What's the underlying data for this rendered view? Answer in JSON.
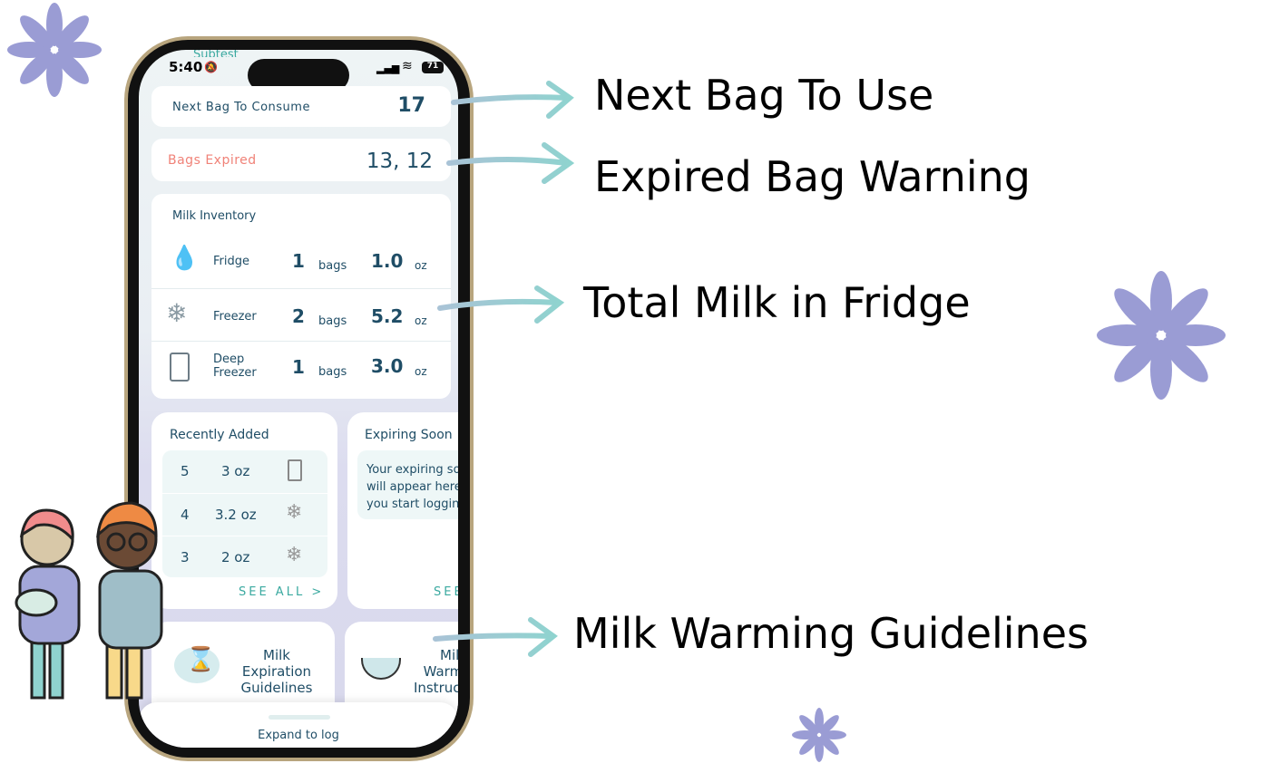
{
  "status": {
    "time": "5:40",
    "battery": "71"
  },
  "app_header_partial": "Subtest",
  "next_bag": {
    "label": "Next Bag To Consume",
    "value": "17"
  },
  "expired": {
    "label": "Bags Expired",
    "value": "13, 12"
  },
  "inventory": {
    "title": "Milk Inventory",
    "rows": [
      {
        "name": "Fridge",
        "count": "1",
        "count_unit": "bags",
        "amount": "1.0",
        "amount_unit": "oz"
      },
      {
        "name": "Freezer",
        "count": "2",
        "count_unit": "bags",
        "amount": "5.2",
        "amount_unit": "oz"
      },
      {
        "name": "Deep Freezer",
        "count": "1",
        "count_unit": "bags",
        "amount": "3.0",
        "amount_unit": "oz"
      }
    ]
  },
  "recent": {
    "title": "Recently Added",
    "rows": [
      {
        "id": "5",
        "amount": "3 oz",
        "icon": "deep-freezer-icon"
      },
      {
        "id": "4",
        "amount": "3.2 oz",
        "icon": "freezer-icon"
      },
      {
        "id": "3",
        "amount": "2 oz",
        "icon": "freezer-icon"
      }
    ],
    "see_all": "SEE ALL >"
  },
  "expiring": {
    "title": "Expiring Soon",
    "message": "Your expiring soon bags will appear here once you start logging",
    "see_all": "SEE ALL >"
  },
  "guides": [
    {
      "label": "Milk Expiration Guidelines"
    },
    {
      "label": "Milk Warming Instructions"
    }
  ],
  "bottom_sheet": {
    "label": "Expand to log"
  },
  "annotations": [
    "Next Bag To Use",
    "Expired Bag Warning",
    "Total Milk in Fridge",
    "Milk Warming Guidelines"
  ],
  "colors": {
    "accent_purple": "#9a9cd4",
    "text_dark": "#1f4d66",
    "expired_red": "#f08278",
    "teal": "#3aa9a0"
  }
}
